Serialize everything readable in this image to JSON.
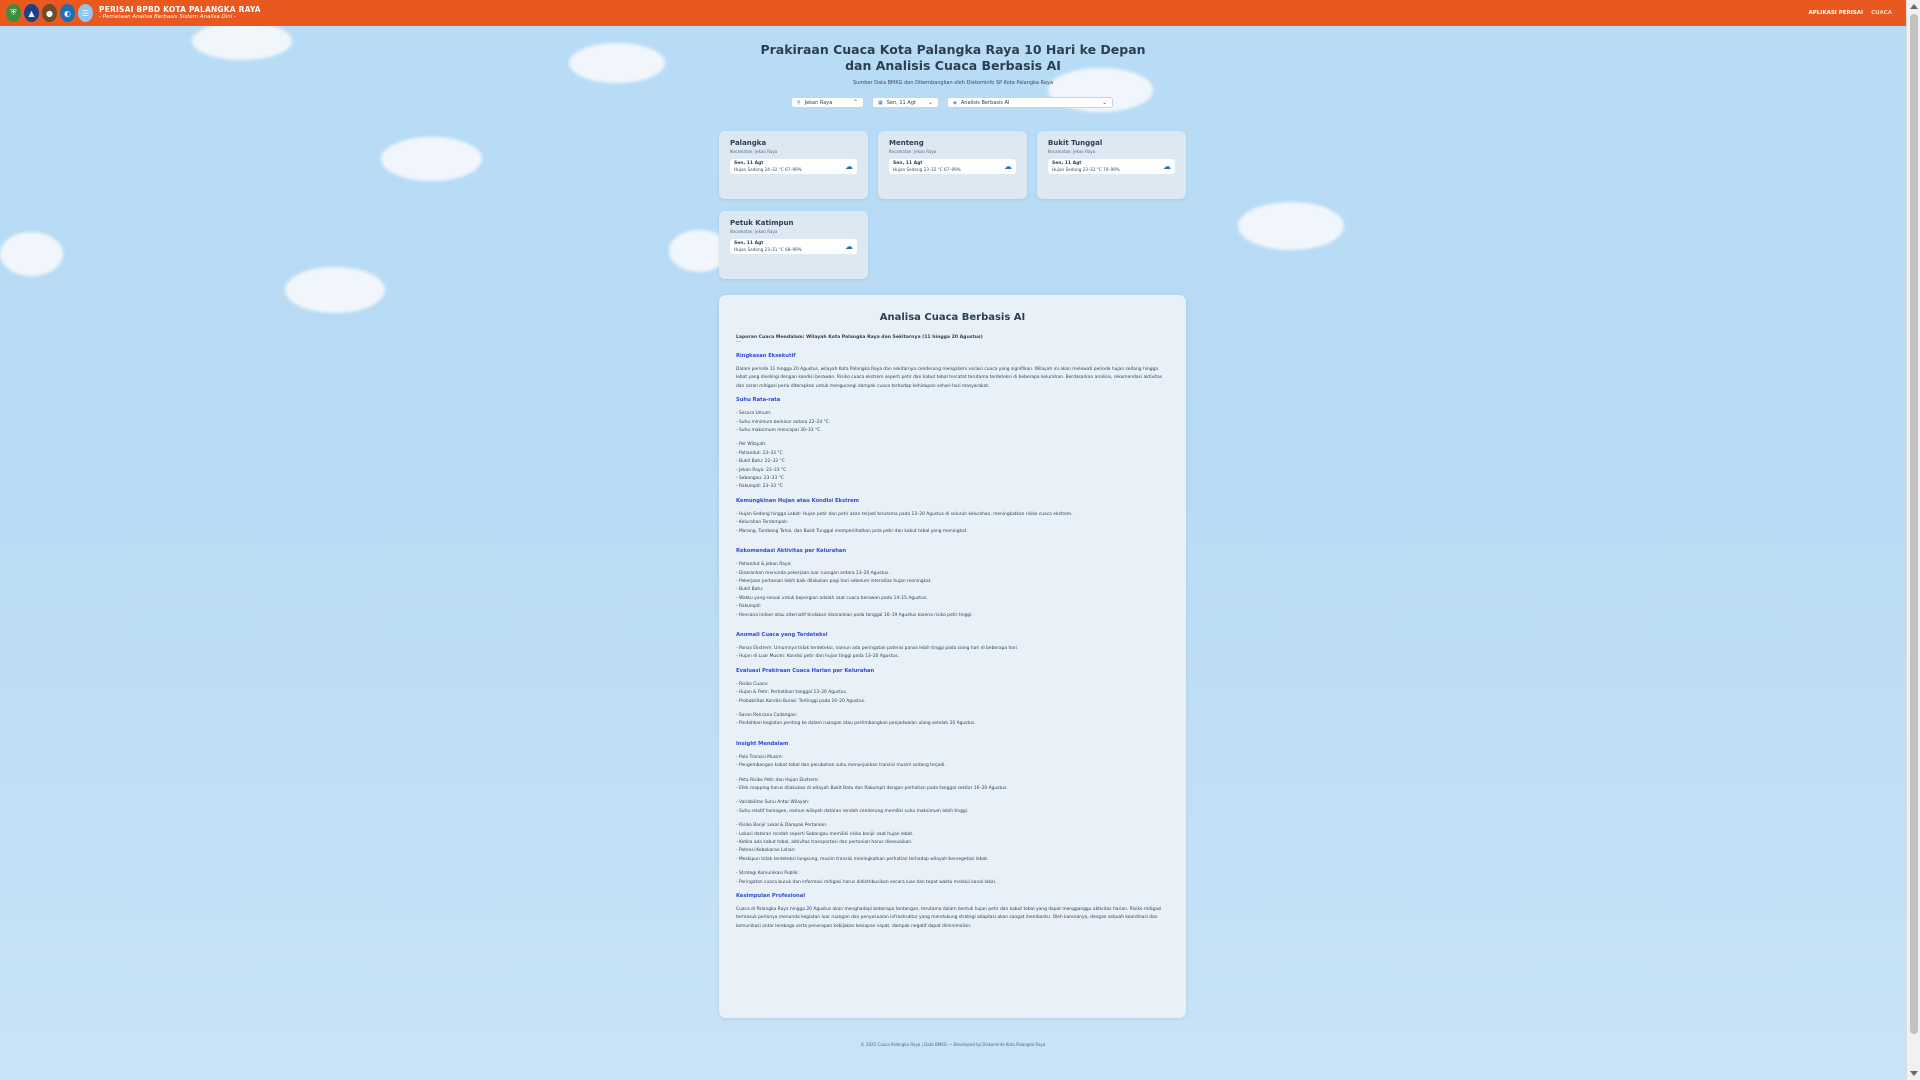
{
  "header": {
    "title": "PERISAI BPBD KOTA PALANGKA RAYA",
    "subtitle": "- Pemetaan Analisa Berbasis Sistem Analisa Dini -",
    "nav": [
      "APLIKASI PERISAI",
      "CUACA"
    ]
  },
  "hero": {
    "title_line1": "Prakiraan Cuaca Kota Palangka Raya 10 Hari ke Depan",
    "title_line2": "dan Analisis Cuaca Berbasis AI",
    "source": "Sumber Data BMKG dan Dikembangkan oleh Diskominfo SP Kota Palangka Raya"
  },
  "filters": {
    "region": "Jekan Raya",
    "date": "Sen, 11 Agt",
    "mode": "Analisis Berbasis AI"
  },
  "cards": [
    {
      "name": "Palangka",
      "kec": "Kecamatan: Jekan Raya",
      "day": "Sen, 11 Agt",
      "desc": "Hujan Sedang 24–32 °C 67–99%"
    },
    {
      "name": "Menteng",
      "kec": "Kecamatan: Jekan Raya",
      "day": "Sen, 11 Agt",
      "desc": "Hujan Sedang 23–32 °C 67–99%"
    },
    {
      "name": "Bukit Tunggal",
      "kec": "Kecamatan: Jekan Raya",
      "day": "Sen, 11 Agt",
      "desc": "Hujan Sedang 23–32 °C 70–99%"
    },
    {
      "name": "Petuk Katimpun",
      "kec": "Kecamatan: Jekan Raya",
      "day": "Sen, 11 Agt",
      "desc": "Hujan Sedang 23–31 °C 68–99%"
    }
  ],
  "analysis": {
    "title": "Analisa Cuaca Berbasis AI",
    "lead": "Laporan Cuaca Mendalam: Wilayah Kota Palangka Raya dan Sekitarnya (11 hingga 20 Agustus)",
    "sep": "---",
    "s1": "Ringkasan Eksekutif",
    "s1p": "Dalam periode 11 hingga 20 Agustus, wilayah Kota Palangka Raya dan sekitarnya cenderung mengalami variasi cuaca yang signifikan. Wilayah ini akan melewati periode hujan sedang hingga lebat yang diselingi dengan kondisi berawan. Risiko cuaca ekstrem seperti petir dan kabut tebal tercatat terutama terdeteksi di beberapa kelurahan. Berdasarkan analisis, rekomendasi aktivitas dan saran mitigasi perlu diterapkan untuk mengurangi dampak cuaca terhadap kehidupan sehari-hari masyarakat.",
    "s2": "Suhu Rata-rata",
    "s2a": "- Secara Umum:",
    "s2b": "- Suhu minimum berkisar antara 22–24 °C.",
    "s2c": "- Suhu maksimum mencapai 30–33 °C.",
    "s2d": "- Per Wilayah:",
    "s2e": "- Pahandut: 23–33 °C",
    "s2f": "- Bukit Batu: 22–33 °C",
    "s2g": "- Jekan Raya: 23–33 °C",
    "s2h": "- Sebangau: 23–33 °C",
    "s2i": "- Rakumpit: 23–33 °C",
    "s3": "Kemungkinan Hujan atau Kondisi Ekstrem",
    "s3a": "- Hujan Sedang hingga Lebat: Hujan petir dan petir akan terjadi terutama pada 13–20 Agustus di seluruh kelurahan, meningkatkan risiko cuaca ekstrem.",
    "s3b": "- Kelurahan Terdampak:",
    "s3c": "- Marang, Tumbang Tahai, dan Bukit Tunggal memperlihatkan pola petir dan kabut tebal yang meningkat.",
    "s4": "Rekomendasi Aktivitas per Kelurahan",
    "s4a": "- Pahandut & Jekan Raya:",
    "s4b": "- Disarankan menunda pekerjaan luar ruangan antara 13–20 Agustus.",
    "s4c": "- Pekerjaan pertanian lebih baik dilakukan pagi hari sebelum intensitas hujan meningkat.",
    "s4d": "- Bukit Batu:",
    "s4e": "- Waktu yang sesuai untuk bepergian adalah saat cuaca berawan pada 14–15 Agustus.",
    "s4f": "- Rakumpit:",
    "s4g": "- Rencana indoor atau alternatif tindakan disarankan pada tanggal 16–19 Agustus karena risiko petir tinggi.",
    "s5": "Anomali Cuaca yang Terdeteksi",
    "s5a": "- Panas Ekstrem: Umumnya tidak terdeteksi, namun ada peringatan potensi panas lebih tinggi pada siang hari di beberapa hari.",
    "s5b": "- Hujan di Luar Musim: Kondisi petir dan hujan tinggi pada 13–20 Agustus.",
    "s6": "Evaluasi Prakiraan Cuaca Harian per Kelurahan",
    "s6a": "- Risiko Cuaca:",
    "s6b": "- Hujan & Petir: Perhatikan tanggal 13–20 Agustus.",
    "s6c": "- Probabilitas Kondisi Buruk: Tertinggi pada 16–20 Agustus.",
    "s6d": "- Saran Rencana Cadangan:",
    "s6e": "- Pindahkan kegiatan penting ke dalam ruangan atau pertimbangkan penjadwalan ulang setelah 20 Agustus.",
    "s7": "Insight Mendalam",
    "s7a": "- Pola Transisi Musim:",
    "s7b": "- Pengembangan kabut tebal dan perubahan suhu menunjukkan transisi musim sedang terjadi.",
    "s7c": "- Peta Risiko Petir dan Hujan Ekstrem:",
    "s7d": "- Efek mapping harus dilakukan di wilayah Bukit Batu dan Rakumpit dengan perhatian pada tanggal sekitar 16–20 Agustus.",
    "s7e": "- Variabilitas Suhu Antar Wilayah:",
    "s7f": "- Suhu relatif homogen, namun wilayah dataran rendah cenderung memiliki suhu maksimum lebih tinggi.",
    "s7g": "- Risiko Banjir Lokal & Dampak Pertanian:",
    "s7h": "- Lokasi dataran rendah seperti Sebangau memiliki risiko banjir saat hujan lebat.",
    "s7i": "- Ketika ada kabut tebal, aktivitas transportasi dan pertanian harus disesuaikan.",
    "s7j": "- Potensi Kebakaran Lahan:",
    "s7k": "- Meskipun tidak terdeteksi langsung, musim transisi meningkatkan perhatian terhadap wilayah bervegetasi lebat.",
    "s7l": "- Strategi Komunikasi Publik:",
    "s7m": "- Peringatan cuaca buruk dan informasi mitigasi harus didistribusikan secara luas dan tepat waktu melalui kanal lokal.",
    "s8": "Kesimpulan Profesional",
    "s8p": "Cuaca di Palangka Raya hingga 20 Agustus akan menghadapi beberapa tantangan, terutama dalam bentuk hujan petir dan kabut tebal yang dapat mengganggu aktivitas harian. Risiko mitigasi termasuk perlunya menunda kegiatan luar ruangan dan penyesuaian infrastruktur yang mendukung strategi adaptasi akan sangat membantu. Oleh karenanya, dengan sebuah koordinasi dan komunikasi antar lembaga serta penerapan kebijakan kesiapan cepat, dampak negatif dapat diminimalisir."
  },
  "footer": "© 2025 Cuaca Palangka Raya | Data BMKG — Developed by Diskominfo Kota Palangka Raya"
}
